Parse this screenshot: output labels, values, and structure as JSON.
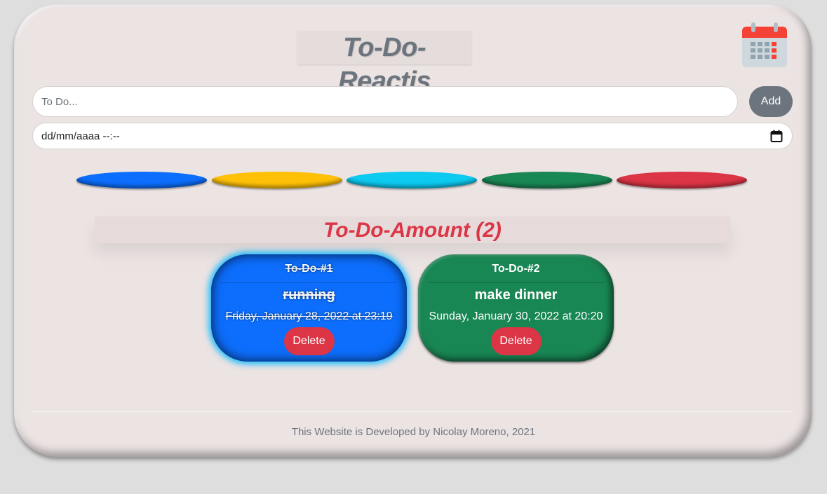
{
  "header": {
    "title": "To-Do-Reactjs",
    "calendar_icon": "calendar-icon"
  },
  "form": {
    "todo_placeholder": "To Do...",
    "todo_value": "",
    "add_label": "Add",
    "date_placeholder": "dd/mm/aaaa --:--"
  },
  "color_options": [
    {
      "name": "primary",
      "color": "#0d6efd"
    },
    {
      "name": "warning",
      "color": "#ffc107"
    },
    {
      "name": "info",
      "color": "#0dcaf0"
    },
    {
      "name": "success",
      "color": "#198754"
    },
    {
      "name": "danger",
      "color": "#dc3545"
    }
  ],
  "amount": {
    "label": "To-Do-Amount (2)"
  },
  "todos": [
    {
      "header": "To-Do-#1",
      "title": "running",
      "date": "Friday, January 28, 2022 at 23:19",
      "completed": true,
      "color": "#0d6efd",
      "delete_label": "Delete"
    },
    {
      "header": "To-Do-#2",
      "title": "make dinner",
      "date": "Sunday, January 30, 2022 at 20:20",
      "completed": false,
      "color": "#198754",
      "delete_label": "Delete"
    }
  ],
  "footer": {
    "text": "This Website is Developed by Nicolay Moreno, 2021"
  }
}
